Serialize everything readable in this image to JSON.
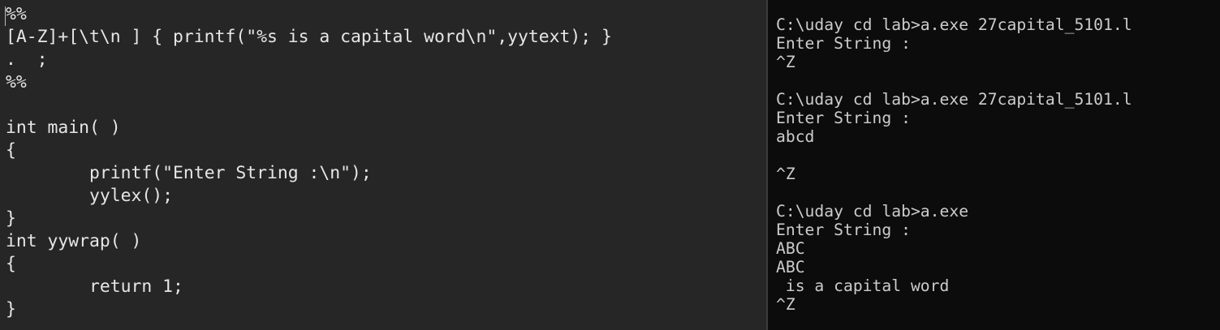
{
  "editor": {
    "lines": [
      "%%",
      "[A-Z]+[\\t\\n ] { printf(\"%s is a capital word\\n\",yytext); }",
      ".  ;",
      "%%",
      "",
      "int main( )",
      "{",
      "\tprintf(\"Enter String :\\n\");",
      "\tyylex();",
      "}",
      "int yywrap( )",
      "{",
      "\treturn 1;",
      "}"
    ]
  },
  "terminal": {
    "lines": [
      "",
      "C:\\uday cd lab>a.exe 27capital_5101.l",
      "Enter String :",
      "^Z",
      "",
      "C:\\uday cd lab>a.exe 27capital_5101.l",
      "Enter String :",
      "abcd",
      "",
      "^Z",
      "",
      "C:\\uday cd lab>a.exe",
      "Enter String :",
      "ABC",
      "ABC",
      " is a capital word",
      "^Z"
    ]
  }
}
